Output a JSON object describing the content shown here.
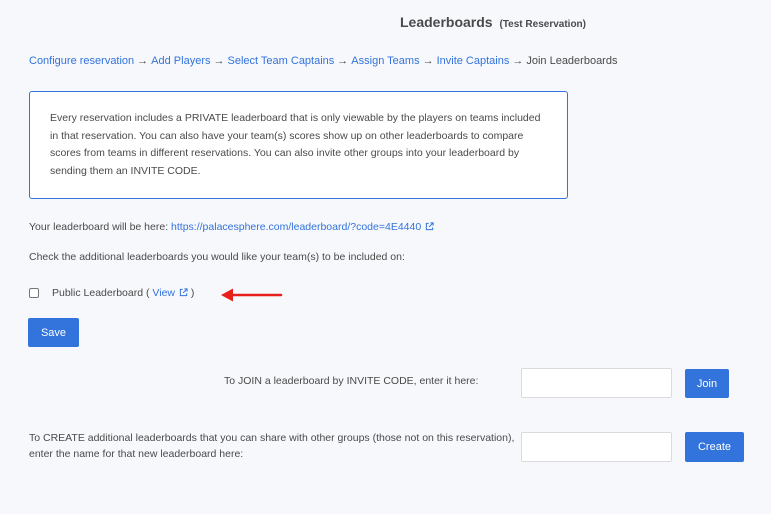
{
  "header": {
    "title": "Leaderboards",
    "subtitle": "(Test Reservation)"
  },
  "breadcrumb": [
    {
      "label": "Configure reservation",
      "link": true
    },
    {
      "label": "Add Players",
      "link": true
    },
    {
      "label": "Select Team Captains",
      "link": true
    },
    {
      "label": "Assign Teams",
      "link": true
    },
    {
      "label": "Invite Captains",
      "link": true
    },
    {
      "label": "Join Leaderboards",
      "link": false
    }
  ],
  "breadcrumb_separator": "→",
  "info_box": {
    "text": "Every reservation includes a PRIVATE leaderboard that is only viewable by the players on teams included in that reservation. You can also have your team(s) scores show up on other leaderboards to compare scores from teams in different reservations. You can also invite other groups into your leaderboard by sending them an INVITE CODE."
  },
  "leaderboard_url": {
    "label": "Your leaderboard will be here:",
    "url": "https://palacesphere.com/leaderboard/?code=4E4440"
  },
  "check_prompt": "Check the additional leaderboards you would like your team(s) to be included on:",
  "public_leaderboard": {
    "label": "Public Leaderboard",
    "open_paren": "(",
    "view_label": "View",
    "close_paren": ")",
    "checked": false
  },
  "annotation_color": "#e8201c",
  "save_label": "Save",
  "join": {
    "label": "To JOIN a leaderboard by INVITE CODE, enter it here:",
    "button_label": "Join",
    "value": ""
  },
  "create": {
    "label": "To CREATE additional leaderboards that you can share with other groups (those not on this reservation), enter the name for that new leaderboard here:",
    "button_label": "Create",
    "value": ""
  }
}
